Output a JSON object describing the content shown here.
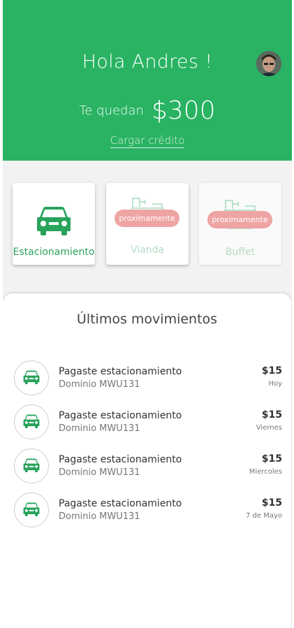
{
  "header": {
    "greeting": "Hola Andres !",
    "balance_label": "Te quedan",
    "balance_amount": "$300",
    "load_credit": "Cargar crédito",
    "background_color": "#29b363"
  },
  "services": [
    {
      "label": "Estacionamiento",
      "icon": "car-icon",
      "badge": ""
    },
    {
      "label": "Vianda",
      "icon": "food-icon",
      "badge": "proximamente"
    },
    {
      "label": "Buffet",
      "icon": "food-icon",
      "badge": "proximamente"
    }
  ],
  "movements": {
    "title": "Últimos movimientos",
    "items": [
      {
        "title": "Pagaste estacionamiento",
        "subtitle": "Dominio MWU131",
        "amount": "$15",
        "date": "Hoy",
        "icon": "car-icon"
      },
      {
        "title": "Pagaste estacionamiento",
        "subtitle": "Dominio MWU131",
        "amount": "$15",
        "date": "Viernes",
        "icon": "car-icon"
      },
      {
        "title": "Pagaste estacionamiento",
        "subtitle": "Dominio MWU131",
        "amount": "$15",
        "date": "Miercoles",
        "icon": "car-icon"
      },
      {
        "title": "Pagaste estacionamiento",
        "subtitle": "Dominio MWU131",
        "amount": "$15",
        "date": "7 de Mayo",
        "icon": "car-icon"
      }
    ]
  },
  "colors": {
    "accent": "#29b363",
    "badge": "#efa4a4"
  }
}
